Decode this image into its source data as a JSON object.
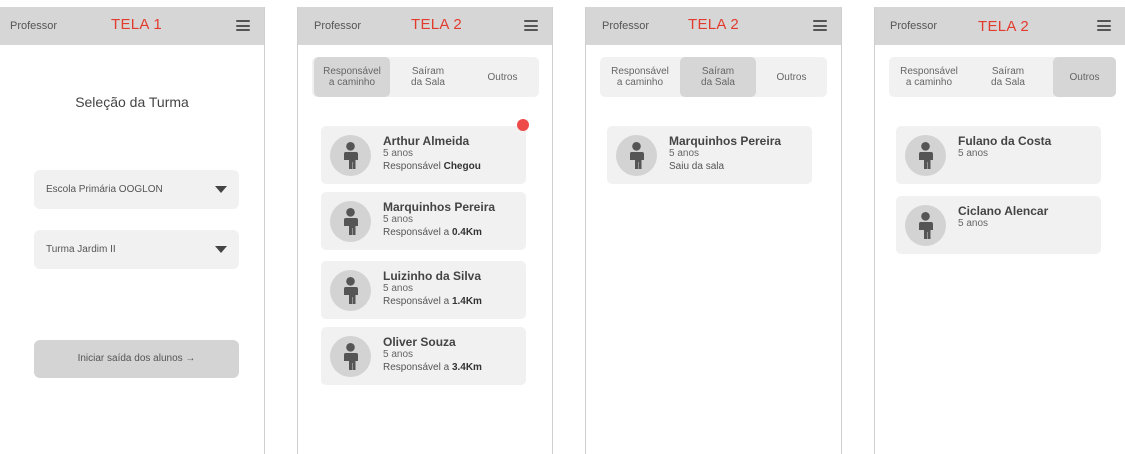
{
  "screens": [
    {
      "header_left": "Professor",
      "title": "TELA 1",
      "selection_title": "Seleção da Turma",
      "school_select": "Escola Primária OOGLON",
      "class_select": "Turma Jardim II",
      "start_button": "Iniciar saída dos alunos →"
    },
    {
      "header_left": "Professor",
      "title": "TELA 2",
      "tabs": [
        "Responsável\na caminho",
        "Saíram\nda Sala",
        "Outros"
      ],
      "active_tab": 0,
      "students": [
        {
          "name": "Arthur Almeida",
          "age": "5 anos",
          "status_prefix": "Responsável ",
          "status_value": "Chegou",
          "notification": true
        },
        {
          "name": "Marquinhos Pereira",
          "age": "5 anos",
          "status_prefix": "Responsável a ",
          "status_value": "0.4Km"
        },
        {
          "name": "Luizinho da Silva",
          "age": "5 anos",
          "status_prefix": "Responsável a ",
          "status_value": "1.4Km"
        },
        {
          "name": "Oliver Souza",
          "age": "5 anos",
          "status_prefix": "Responsável a ",
          "status_value": "3.4Km"
        }
      ]
    },
    {
      "header_left": "Professor",
      "title": "TELA 2",
      "tabs": [
        "Responsável\na caminho",
        "Saíram\nda Sala",
        "Outros"
      ],
      "active_tab": 1,
      "students": [
        {
          "name": "Marquinhos Pereira",
          "age": "5 anos",
          "status_prefix": "Saiu da sala",
          "status_value": ""
        }
      ]
    },
    {
      "header_left": "Professor",
      "title": "TELA 2",
      "tabs": [
        "Responsável\na caminho",
        "Saíram\nda Sala",
        "Outros"
      ],
      "active_tab": 2,
      "students": [
        {
          "name": "Fulano da Costa",
          "age": "5 anos"
        },
        {
          "name": "Ciclano Alencar",
          "age": "5 anos"
        }
      ]
    }
  ],
  "colors": {
    "title_red": "#e23b2e",
    "notification_dot": "#ee4a4a",
    "header_bg": "#d6d6d6",
    "card_bg": "#f1f1f1"
  },
  "icons": {
    "menu": "hamburger-menu-icon",
    "avatar": "child-person-icon",
    "dropdown": "caret-down-icon"
  }
}
